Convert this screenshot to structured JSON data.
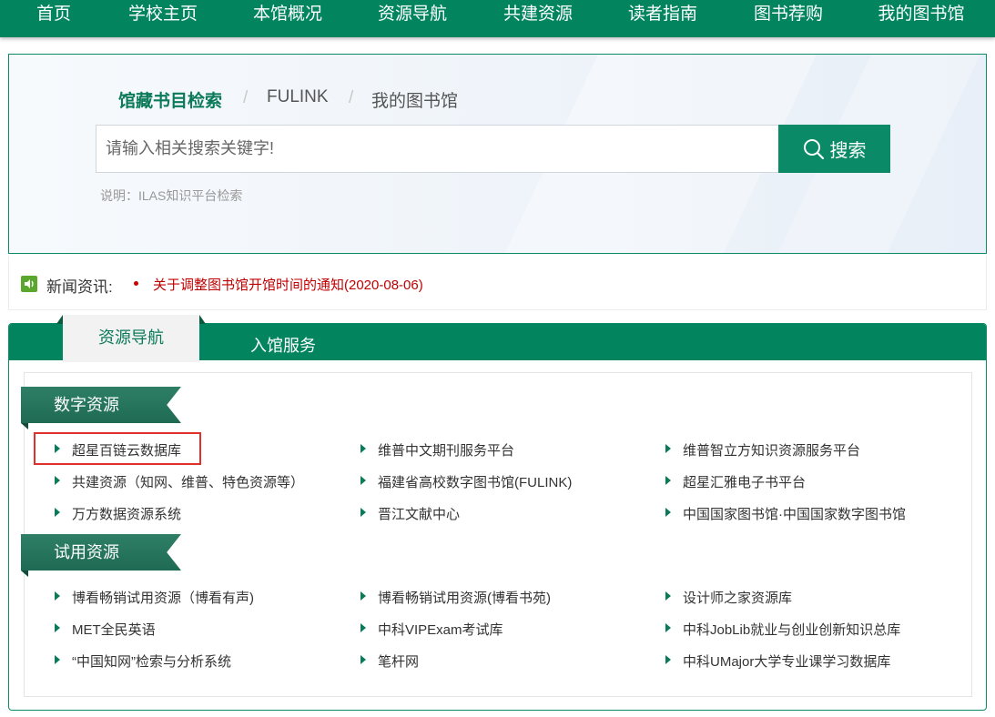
{
  "topnav": {
    "items": [
      "首页",
      "学校主页",
      "本馆概况",
      "资源导航",
      "共建资源",
      "读者指南",
      "图书荐购",
      "我的图书馆"
    ]
  },
  "search": {
    "tabs": [
      "馆藏书目检索",
      "FULINK",
      "我的图书馆"
    ],
    "separator": "/",
    "placeholder": "请输入相关搜索关键字!",
    "button_label": "搜索",
    "note": "说明：ILAS知识平台检索"
  },
  "news": {
    "label": "新闻资讯:",
    "item": "关于调整图书馆开馆时间的通知(2020-08-06)"
  },
  "resources": {
    "tabs": [
      "资源导航",
      "入馆服务"
    ],
    "sections": [
      {
        "title": "数字资源",
        "items": [
          "超星百链云数据库",
          "维普中文期刊服务平台",
          "维普智立方知识资源服务平台",
          "共建资源（知网、维普、特色资源等）",
          "福建省高校数字图书馆(FULINK)",
          "超星汇雅电子书平台",
          "万方数据资源系统",
          "晋江文献中心",
          "中国国家图书馆·中国国家数字图书馆"
        ]
      },
      {
        "title": "试用资源",
        "items": [
          "博看畅销试用资源（博看有声)",
          "博看畅销试用资源(博看书苑)",
          "设计师之家资源库",
          "MET全民英语",
          "中科VIPExam考试库",
          "中科JobLib就业与创业创新知识总库",
          "“中国知网”检索与分析系统",
          "笔杆网",
          "中科UMajor大学专业课学习数据库"
        ]
      }
    ]
  },
  "colors": {
    "brand_green": "#02855f",
    "news_red": "#c00000",
    "highlight": "#e0302c"
  }
}
